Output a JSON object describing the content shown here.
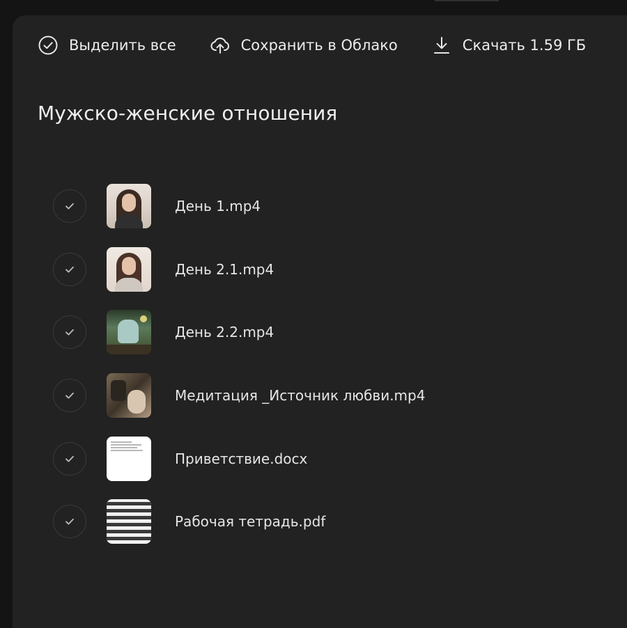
{
  "toolbar": {
    "select_all_label": "Выделить все",
    "save_cloud_label": "Сохранить в Облако",
    "download_label": "Скачать 1.59 ГБ"
  },
  "folder": {
    "title": "Мужско-женские отношения"
  },
  "files": [
    {
      "name": "День 1.mp4",
      "thumb": "video-portrait"
    },
    {
      "name": "День 2.1.mp4",
      "thumb": "video-portrait"
    },
    {
      "name": "День 2.2.mp4",
      "thumb": "video-scene"
    },
    {
      "name": "Медитация _Источник любви.mp4",
      "thumb": "video-meditation"
    },
    {
      "name": "Приветствие.docx",
      "thumb": "document"
    },
    {
      "name": "Рабочая тетрадь.pdf",
      "thumb": "pdf"
    }
  ],
  "icons": {
    "select_all": "check-circle-icon",
    "save_cloud": "cloud-upload-icon",
    "download": "download-icon",
    "row_check": "check-icon"
  },
  "colors": {
    "background": "#141414",
    "panel": "#222222",
    "text": "#ececec",
    "check_border": "#3a3a3a"
  }
}
